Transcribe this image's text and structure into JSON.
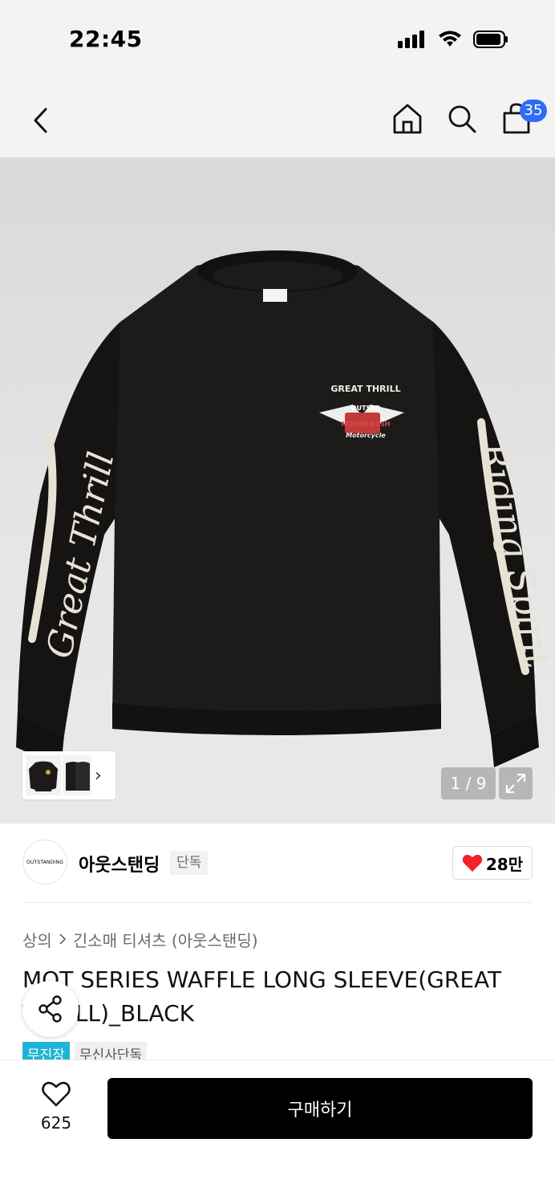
{
  "status_bar": {
    "time": "22:45"
  },
  "nav": {
    "cart_count": "35"
  },
  "gallery": {
    "page_indicator": "1 / 9",
    "print_chest_top": "GREAT THRILL",
    "print_chest_badge": "OUTSTD",
    "print_chest_mid": "MOTOR RUSH",
    "print_chest_bottom": "Motorcycle",
    "print_sleeve_left": "Great Thrill",
    "print_sleeve_right": "Riding Spirit"
  },
  "brand": {
    "logo_text": "OUTSTANDING",
    "name": "아웃스탠딩",
    "tag": "단독",
    "likes": "28만"
  },
  "breadcrumb": {
    "first": "상의",
    "second": "긴소매 티셔츠 (아웃스탠딩)"
  },
  "product": {
    "title_line1": "MOT SERIES WAFFLE LONG SLEEVE(GREAT",
    "title_line2": "THRILL)_BLACK",
    "badges": [
      "무진장",
      "무신사단독"
    ]
  },
  "bottom_bar": {
    "wish_count": "625",
    "buy_label": "구매하기"
  },
  "colors": {
    "accent_blue": "#2f6cf5",
    "badge_teal": "#1fb4d4",
    "heart_red": "#f0232b"
  }
}
